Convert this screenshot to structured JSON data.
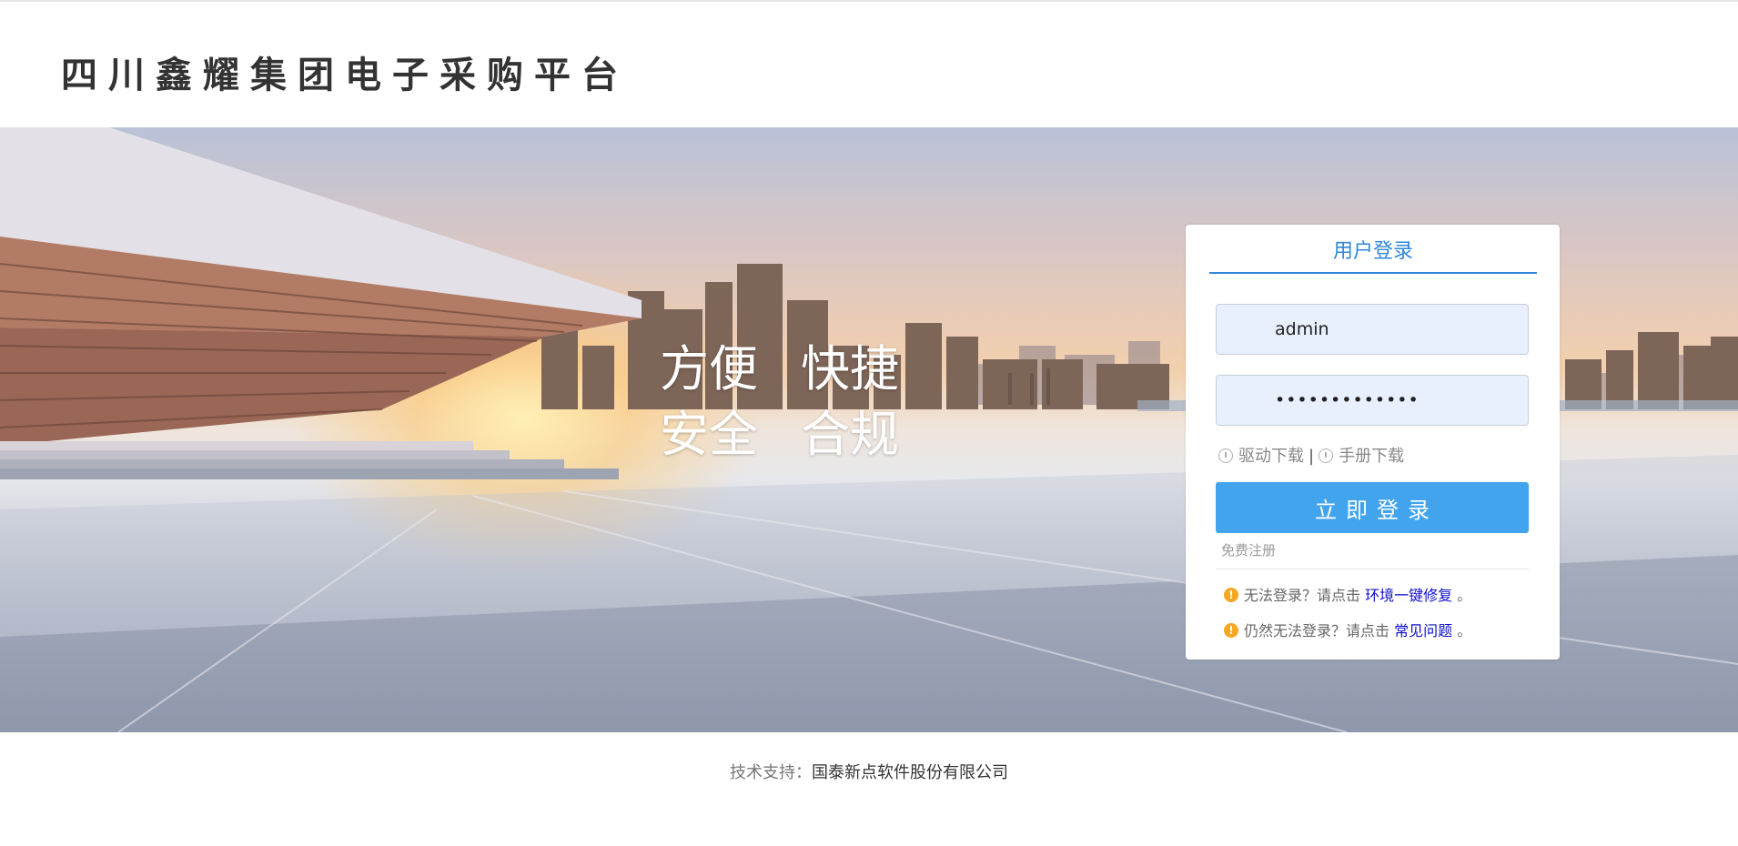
{
  "header": {
    "title": "四川鑫耀集团电子采购平台"
  },
  "banner": {
    "slogan_row1": [
      "方便",
      "快捷"
    ],
    "slogan_row2": [
      "安全",
      "合规"
    ]
  },
  "login": {
    "tab_label": "用户登录",
    "username_value": "admin",
    "password_value": "•••••••••••••",
    "driver_download": "驱动下载",
    "separator": "|",
    "manual_download": "手册下载",
    "submit_label": "立即登录",
    "register_label": "免费注册",
    "help1_text": "无法登录？请点击",
    "help1_link": "环境一键修复",
    "help1_end": "。",
    "help2_text": "仍然无法登录？请点击",
    "help2_link": "常见问题",
    "help2_end": "。"
  },
  "footer": {
    "label": "技术支持：",
    "company": "国泰新点软件股份有限公司"
  },
  "colors": {
    "accent": "#2f87d9",
    "button": "#43a4ee",
    "warning": "#f5a623",
    "link": "#1010cc"
  }
}
